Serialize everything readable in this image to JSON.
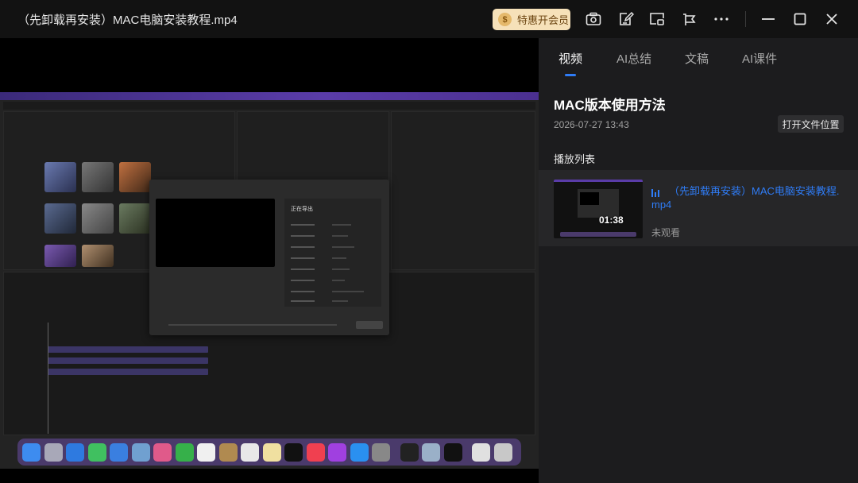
{
  "window": {
    "title": "（先卸载再安装）MAC电脑安装教程.mp4",
    "vip_coin": "$",
    "vip_label": "特惠开会员"
  },
  "toolbar_icons": [
    "camera-icon",
    "edit-note-icon",
    "picture-in-picture-icon",
    "share-icon",
    "more-icon",
    "minimize-icon",
    "maximize-icon",
    "close-icon"
  ],
  "tabs": [
    {
      "label": "视频",
      "active": true
    },
    {
      "label": "AI总结",
      "active": false
    },
    {
      "label": "文稿",
      "active": false
    },
    {
      "label": "AI课件",
      "active": false
    }
  ],
  "video_info": {
    "title": "MAC版本使用方法",
    "date": "2026-07-27 13:43",
    "open_location_label": "打开文件位置"
  },
  "playlist": {
    "title": "播放列表",
    "items": [
      {
        "name": "（先卸载再安装）MAC电脑安装教程.mp4",
        "duration": "01:38",
        "status": "未观看",
        "playing": true
      }
    ]
  },
  "screen_content": {
    "dialog_title": "正在导出"
  },
  "colors": {
    "accent": "#2f7cf6",
    "vip_bg": "#f6e1b9",
    "panel_bg": "#1c1c1e",
    "titlebar_bg": "#121212"
  }
}
